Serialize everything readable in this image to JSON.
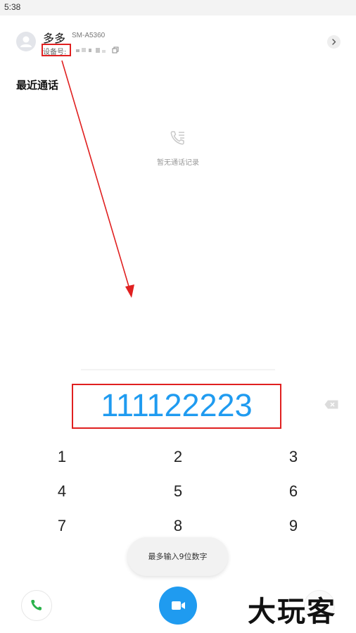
{
  "status_bar": {
    "time": "5:38"
  },
  "header": {
    "contact_name": "多多",
    "device_model": "SM-A5360",
    "device_label": "设备号:",
    "avatar_icon": "person-icon",
    "copy_icon": "copy-icon",
    "chevron_icon": "chevron-right-icon"
  },
  "recent": {
    "title": "最近通话",
    "empty_icon": "phone-log-icon",
    "empty_text": "暂无通话记录"
  },
  "dialer": {
    "number": "111122223",
    "backspace_icon": "backspace-icon",
    "keys": [
      "1",
      "2",
      "3",
      "4",
      "5",
      "6",
      "7",
      "8",
      "9"
    ]
  },
  "toast": {
    "text": "最多输入9位数字"
  },
  "bottom_bar": {
    "call_icon": "phone-icon",
    "video_icon": "video-camera-icon"
  },
  "watermark": {
    "text": "大玩客"
  },
  "colors": {
    "accent": "#1f9bf0",
    "call_green": "#2ab24b",
    "annotation_red": "#e02020"
  }
}
